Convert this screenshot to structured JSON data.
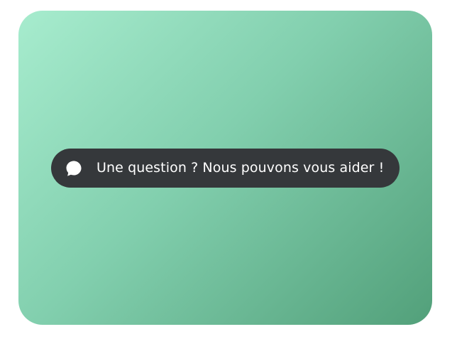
{
  "chat_widget": {
    "label": "Une question ? Nous pouvons vous aider !",
    "icon": "chat-bubble-icon"
  },
  "colors": {
    "pill_background": "#35383b",
    "text": "#ffffff",
    "gradient_start": "#a7ecce",
    "gradient_mid": "#82cfae",
    "gradient_end": "#52a07a"
  }
}
